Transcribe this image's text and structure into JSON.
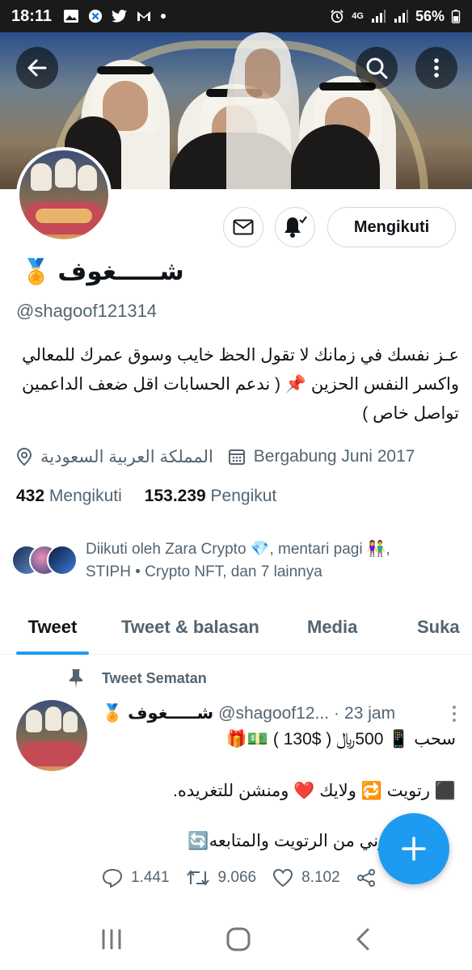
{
  "status_bar": {
    "time": "18:11",
    "network": "4G",
    "battery": "56%",
    "left_icons": [
      "gallery-icon",
      "x-icon",
      "twitter-icon",
      "gmail-icon",
      "dot-icon"
    ],
    "right_icons": [
      "alarm-icon",
      "signal-icon",
      "signal-icon",
      "battery-icon"
    ]
  },
  "profile": {
    "display_name": "شـــــغوف",
    "medal": "🏅",
    "handle": "@shagoof121314",
    "follow_button_label": "Mengikuti",
    "bio_lines": [
      "عـز نفسك في زمانك لا تقول الحظ خايب وسوق عمرك للمعالي",
      "واكسر النفس الحزين 📌 ( ندعم الحسابات  اقل ضعف الداعمين",
      "تواصل خاص )"
    ],
    "location": "المملكة العربية السعودية",
    "joined": "Bergabung Juni 2017",
    "following_count": "432",
    "following_label": "Mengikuti",
    "followers_count": "153.239",
    "followers_label": "Pengikut",
    "followed_by_line1": "Diikuti oleh Zara Crypto 💎, mentari pagi 👫,",
    "followed_by_line2": "STIPH • Crypto NFT, dan 7 lainnya"
  },
  "tabs": [
    {
      "label": "Tweet",
      "active": true
    },
    {
      "label": "Tweet & balasan",
      "active": false
    },
    {
      "label": "Media",
      "active": false
    },
    {
      "label": "Suka",
      "active": false
    }
  ],
  "pinned_tweet": {
    "pinned_label": "Tweet Sematan",
    "author_name": "شـــــغوف",
    "medal": "🏅",
    "author_handle": "@shagoof12...",
    "separator": "·",
    "time": "23 jam",
    "lines": [
      "سحب 📱 500﷼ ( $130 ) 💵🎁",
      "⬛ رتويت 🔁  ولايك ❤️  ومنشن للتغريده.",
      "⬛ الكتروني من الرتويت والمتابعه🔄"
    ],
    "replies": "1.441",
    "retweets": "9.066",
    "likes": "8.102"
  },
  "colors": {
    "accent": "#1d9bf0",
    "text_primary": "#0f1419",
    "text_secondary": "#536471",
    "border": "#cfd9de"
  }
}
